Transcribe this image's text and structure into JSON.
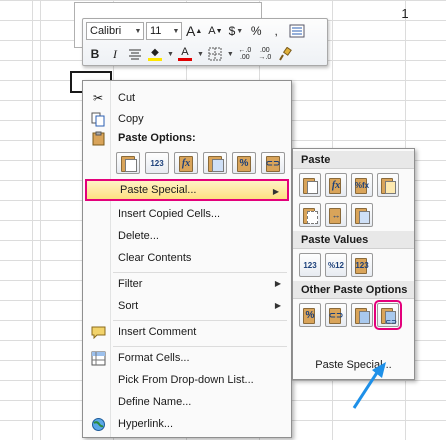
{
  "sheet": {
    "row_number": "1"
  },
  "toolbar": {
    "font": "Calibri",
    "size": "11",
    "grow_font": "A",
    "shrink_font": "A",
    "currency": "$",
    "percent": "%",
    "comma": ",",
    "bold": "B",
    "italic": "I",
    "font_color_letter": "A",
    "fill_color": "#ffe600",
    "font_color": "#e00000"
  },
  "menu": {
    "cut": "Cut",
    "copy": "Copy",
    "paste_options": "Paste Options:",
    "paste_special": "Paste Special...",
    "insert_copied": "Insert Copied Cells...",
    "delete": "Delete...",
    "clear_contents": "Clear Contents",
    "filter": "Filter",
    "sort": "Sort",
    "insert_comment": "Insert Comment",
    "format_cells": "Format Cells...",
    "pick_dropdown": "Pick From Drop-down List...",
    "define_name": "Define Name...",
    "hyperlink": "Hyperlink..."
  },
  "paste_icon_glyphs": [
    "",
    "123",
    "fx",
    "",
    "%",
    ""
  ],
  "submenu": {
    "paste": "Paste",
    "paste_values": "Paste Values",
    "other": "Other Paste Options",
    "paste_special_link": "Paste Special..."
  },
  "colors": {
    "highlight_border": "#e3007b",
    "arrow": "#1e90e8"
  }
}
